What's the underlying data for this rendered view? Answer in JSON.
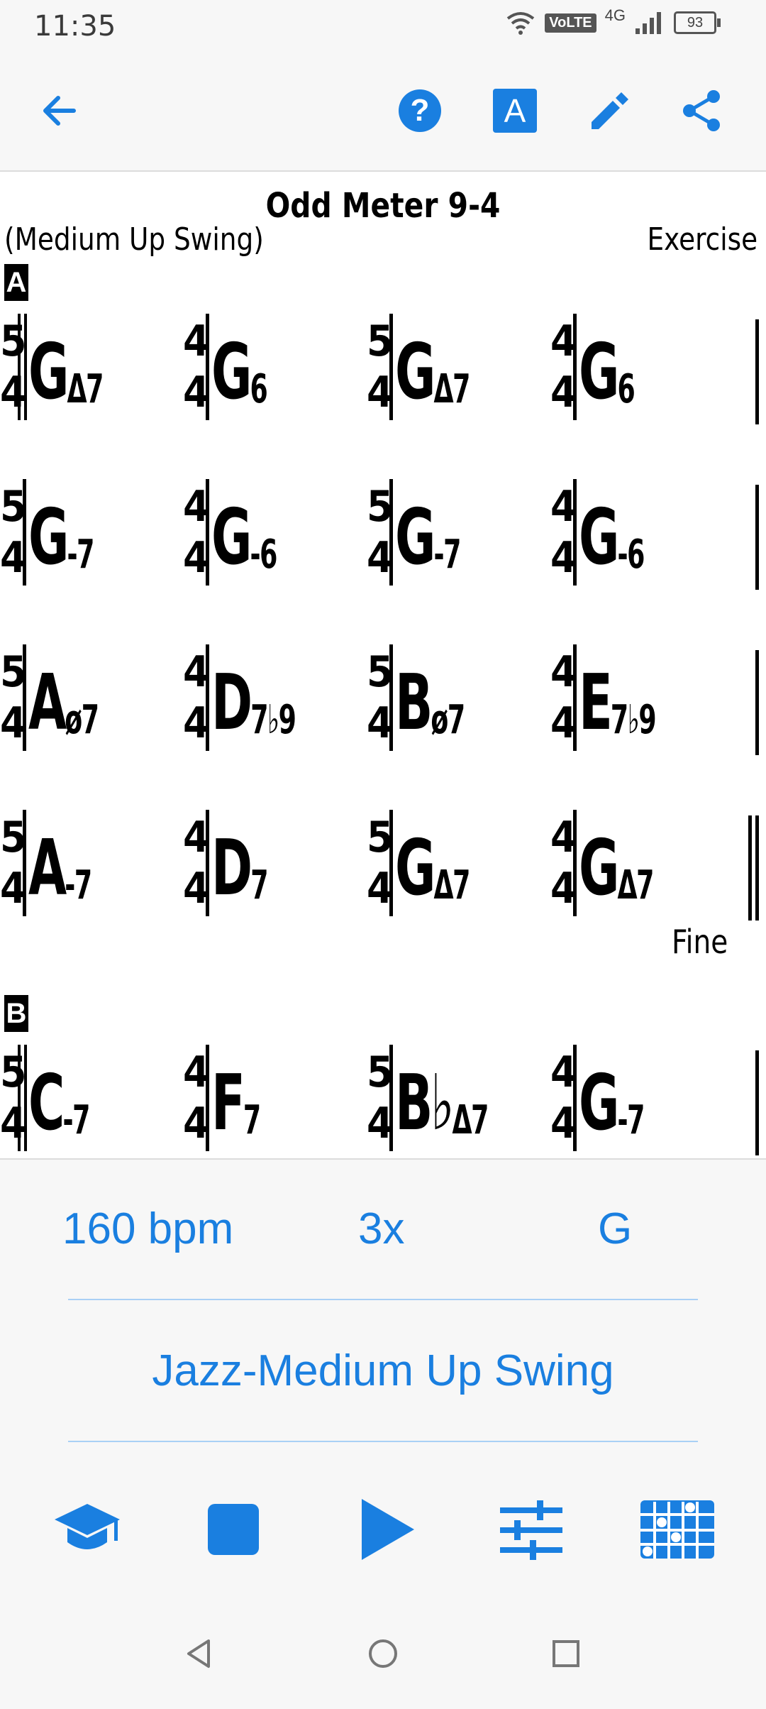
{
  "status": {
    "time": "11:35",
    "volte": "VoLTE",
    "network": "4G",
    "battery": "93"
  },
  "appbar": {
    "icons": [
      "back-arrow-icon",
      "help-icon",
      "font-a-icon",
      "edit-pencil-icon",
      "share-icon"
    ],
    "font_icon_letter": "A",
    "help_icon_glyph": "?"
  },
  "chart": {
    "title": "Odd Meter 9-4",
    "style": "(Medium Up Swing)",
    "composer": "Exercise",
    "sections": [
      {
        "label": "A",
        "rows": [
          {
            "measures": [
              {
                "ts_top": "5",
                "ts_bot": "4",
                "root": "G",
                "qual": "Δ7"
              },
              {
                "ts_top": "4",
                "ts_bot": "4",
                "root": "G",
                "qual": "6"
              },
              {
                "ts_top": "5",
                "ts_bot": "4",
                "root": "G",
                "qual": "Δ7"
              },
              {
                "ts_top": "4",
                "ts_bot": "4",
                "root": "G",
                "qual": "6"
              }
            ]
          },
          {
            "measures": [
              {
                "ts_top": "5",
                "ts_bot": "4",
                "root": "G",
                "qual": "-7"
              },
              {
                "ts_top": "4",
                "ts_bot": "4",
                "root": "G",
                "qual": "-6"
              },
              {
                "ts_top": "5",
                "ts_bot": "4",
                "root": "G",
                "qual": "-7"
              },
              {
                "ts_top": "4",
                "ts_bot": "4",
                "root": "G",
                "qual": "-6"
              }
            ]
          },
          {
            "measures": [
              {
                "ts_top": "5",
                "ts_bot": "4",
                "root": "A",
                "qual": "ø7"
              },
              {
                "ts_top": "4",
                "ts_bot": "4",
                "root": "D",
                "qual": "7♭9"
              },
              {
                "ts_top": "5",
                "ts_bot": "4",
                "root": "B",
                "qual": "ø7"
              },
              {
                "ts_top": "4",
                "ts_bot": "4",
                "root": "E",
                "qual": "7♭9"
              }
            ]
          },
          {
            "measures": [
              {
                "ts_top": "5",
                "ts_bot": "4",
                "root": "A",
                "qual": "-7"
              },
              {
                "ts_top": "4",
                "ts_bot": "4",
                "root": "D",
                "qual": "7"
              },
              {
                "ts_top": "5",
                "ts_bot": "4",
                "root": "G",
                "qual": "Δ7"
              },
              {
                "ts_top": "4",
                "ts_bot": "4",
                "root": "G",
                "qual": "Δ7"
              }
            ]
          }
        ],
        "end_text": "Fine"
      },
      {
        "label": "B",
        "rows": [
          {
            "measures": [
              {
                "ts_top": "5",
                "ts_bot": "4",
                "root": "C",
                "qual": "-7"
              },
              {
                "ts_top": "4",
                "ts_bot": "4",
                "root": "F",
                "qual": "7"
              },
              {
                "ts_top": "5",
                "ts_bot": "4",
                "root": "B♭",
                "qual": "Δ7"
              },
              {
                "ts_top": "4",
                "ts_bot": "4",
                "root": "G",
                "qual": "-7"
              }
            ]
          }
        ]
      }
    ]
  },
  "controls": {
    "tempo": "160 bpm",
    "repeats": "3x",
    "key": "G",
    "style": "Jazz-Medium Up Swing",
    "accent_color": "#1a7fe0",
    "bottom_icons": [
      "practice-graduation-cap-icon",
      "stop-icon",
      "play-icon",
      "mixer-sliders-icon",
      "chord-diagram-grid-icon"
    ]
  },
  "navbar": {
    "icons": [
      "nav-back-icon",
      "nav-home-icon",
      "nav-recents-icon"
    ]
  }
}
